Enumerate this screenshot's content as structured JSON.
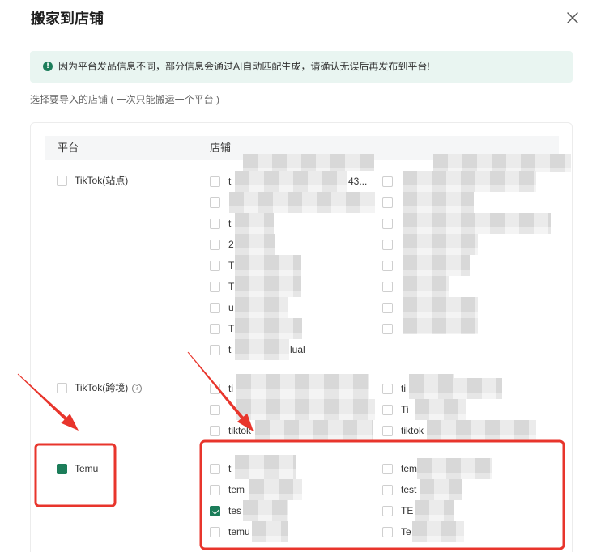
{
  "dialog": {
    "title": "搬家到店铺",
    "close_icon": "close-icon"
  },
  "notice": {
    "icon": "exclamation-circle-icon",
    "text": "因为平台发品信息不同，部分信息会通过AI自动匹配生成，请确认无误后再发布到平台!"
  },
  "instruction": "选择要导入的店铺 ( 一次只能搬运一个平台 )",
  "table": {
    "headers": [
      "平台",
      "店铺"
    ],
    "platforms": [
      {
        "name": "TikTok(站点)",
        "checked": false,
        "indeterminate": false,
        "store_columns": [
          [
            {
              "label": "t",
              "tail": "43...",
              "checked": false
            },
            {
              "checked": false
            },
            {
              "label": "t",
              "checked": false
            },
            {
              "label": "2",
              "checked": false
            },
            {
              "label": "T",
              "checked": false
            },
            {
              "label": "T",
              "checked": false
            },
            {
              "label": "u",
              "checked": false
            },
            {
              "label": "T",
              "checked": false
            },
            {
              "label": "t",
              "tail": "lual",
              "checked": false
            }
          ],
          [
            {
              "checked": false
            },
            {
              "checked": false
            },
            {
              "checked": false
            },
            {
              "checked": false
            },
            {
              "checked": false
            },
            {
              "checked": false
            },
            {
              "checked": false
            },
            {
              "checked": false
            }
          ]
        ]
      },
      {
        "name": "TikTok(跨境)",
        "help_icon": "question-circle-icon",
        "checked": false,
        "indeterminate": false,
        "store_columns": [
          [
            {
              "label": "ti",
              "checked": false
            },
            {
              "checked": false
            },
            {
              "label": "tiktok",
              "checked": false
            }
          ],
          [
            {
              "label": "ti",
              "checked": false
            },
            {
              "label": "Ti",
              "checked": false
            },
            {
              "label": "tiktok",
              "checked": false
            }
          ]
        ]
      },
      {
        "name": "Temu",
        "checked": false,
        "indeterminate": true,
        "store_columns": [
          [
            {
              "label": "t",
              "checked": false
            },
            {
              "label": "tem",
              "checked": false
            },
            {
              "label": "tes",
              "checked": true
            },
            {
              "label": "temu",
              "checked": false
            }
          ],
          [
            {
              "label": "tem",
              "checked": false
            },
            {
              "label": "test",
              "checked": false
            },
            {
              "label": "TE",
              "checked": false
            },
            {
              "label": "Te",
              "checked": false
            }
          ]
        ]
      }
    ]
  },
  "colors": {
    "primary": "#1c7d5a",
    "notice_bg": "#e9f5f1",
    "annotation_red": "#e8352c"
  }
}
